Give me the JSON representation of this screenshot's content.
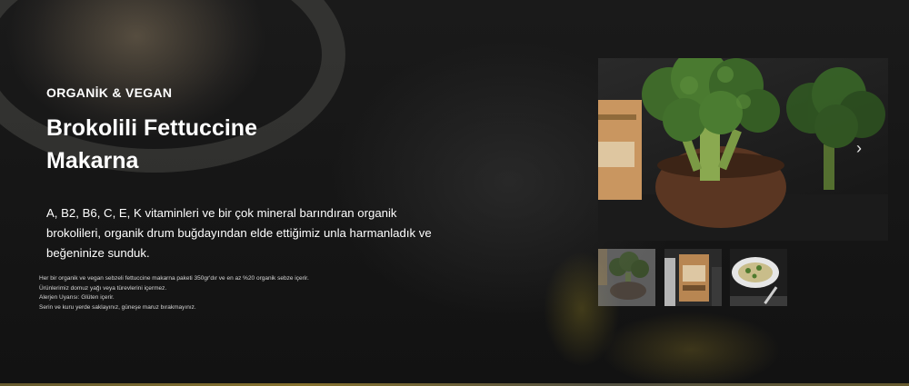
{
  "hero": {
    "eyebrow": "ORGANİK & VEGAN",
    "title": "Brokolili Fettuccine Makarna",
    "description": "A, B2, B6, C, E, K vitaminleri ve bir çok mineral barındıran organik brokolileri, organik drum buğdayından elde ettiğimiz unla harmanladık ve beğeninize sunduk."
  },
  "notes": [
    "Her bir organik ve vegan sebzeli fettuccine makarna paketi 350gr'dır ve en az %20 organik sebze içerir.",
    "Ürünlerimiz domuz yağı veya türevlerini içermez.",
    "Alerjen Uyarısı: Glüten içerir.",
    "Serin ve kuru yerde saklayınız, güneşe maruz bırakmayınız."
  ],
  "gallery": {
    "next_icon": "chevron-right-icon",
    "next_glyph": "›",
    "thumbnails": [
      "broccoli-thumbnail",
      "package-thumbnail",
      "plated-pasta-thumbnail"
    ],
    "active_thumbnail": 1
  },
  "colors": {
    "background": "#151515",
    "text": "#ffffff",
    "broccoli": "#3f6a2a",
    "package": "#c99660"
  }
}
